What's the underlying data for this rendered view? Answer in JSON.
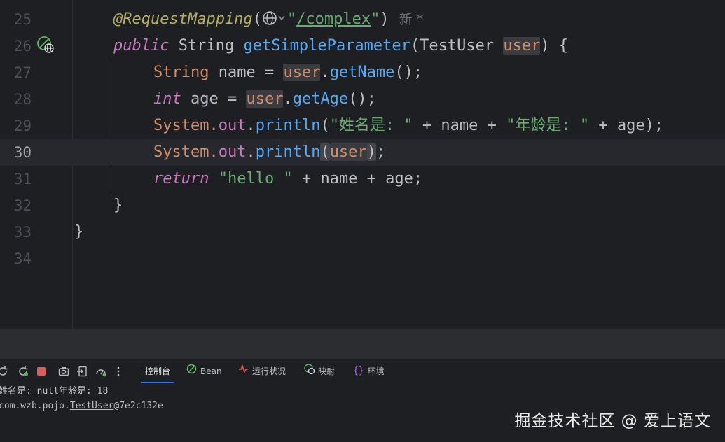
{
  "editor": {
    "current_line": "30",
    "lines": [
      {
        "num": "25"
      },
      {
        "num": "26"
      },
      {
        "num": "27"
      },
      {
        "num": "28"
      },
      {
        "num": "29"
      },
      {
        "num": "30"
      },
      {
        "num": "31"
      },
      {
        "num": "32"
      },
      {
        "num": "33"
      },
      {
        "num": "34"
      }
    ],
    "tokens": {
      "l25_ann": "@RequestMapping",
      "l25_paren_open": "(",
      "l25_q1": "\"",
      "l25_path": "/complex",
      "l25_q2": "\"",
      "l25_paren_close": ")",
      "l25_hint": "新 *",
      "l26_public": "public",
      "l26_type": " String ",
      "l26_fn": "getSimpleParameter",
      "l26_paren": "(TestUser ",
      "l26_param": "user",
      "l26_end": ") {",
      "l27_type": "String",
      "l27_mid": " name = ",
      "l27_user": "user",
      "l27_dot": ".",
      "l27_fn": "getName",
      "l27_end": "();",
      "l28_int": "int",
      "l28_mid": " age = ",
      "l28_user": "user",
      "l28_dot": ".",
      "l28_fn": "getAge",
      "l28_end": "();",
      "l29_sys": "System.",
      "l29_out": "out",
      "l29_dot": ".",
      "l29_fn": "println",
      "l29_p": "(",
      "l29_s1": "\"姓名是: \"",
      "l29_mid": " + name + ",
      "l29_s2": "\"年龄是: \"",
      "l29_end": " + age);",
      "l30_sys": "System.",
      "l30_out": "out",
      "l30_dot": ".",
      "l30_fn": "println",
      "l30_p1": "(",
      "l30_user": "user",
      "l30_p2": ")",
      "l30_end": ";",
      "l31_return": "return",
      "l31_sp": " ",
      "l31_str": "\"hello \"",
      "l31_end": " + name + age;",
      "l32": "}",
      "l33": "}"
    }
  },
  "toolbar": {
    "tabs": [
      {
        "label": "控制台"
      },
      {
        "label": "Bean"
      },
      {
        "label": "运行状况"
      },
      {
        "label": "映射"
      },
      {
        "label": "环境"
      }
    ]
  },
  "console": {
    "line1": "姓名是: null年龄是: 18",
    "line2_prefix": "com.wzb.pojo.",
    "line2_class": "TestUser",
    "line2_suffix": "@7e2c132e"
  },
  "watermark": "掘金技术社区 @ 爱上语文",
  "colors": {
    "background": "#1e1f22",
    "keyword": "#cf8e6d",
    "string": "#6aab73",
    "function": "#56a8f5",
    "field": "#c77dbb",
    "annotation": "#b3ae60",
    "active_tab_underline": "#3574f0"
  }
}
